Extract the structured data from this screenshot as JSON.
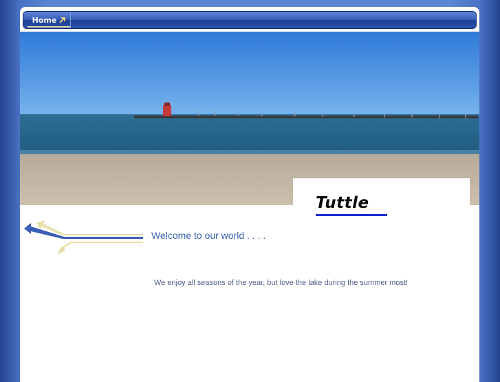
{
  "nav": {
    "home_label": "Home"
  },
  "site": {
    "name": "Tuttle"
  },
  "content": {
    "welcome": "Welcome to our world . . . .",
    "tagline": "We enjoy all seasons of the year, but love the lake during the summer most!"
  },
  "icons": {
    "nav_arrow": "arrow-up-right-icon",
    "decoration": "swoosh-arrows-icon"
  }
}
